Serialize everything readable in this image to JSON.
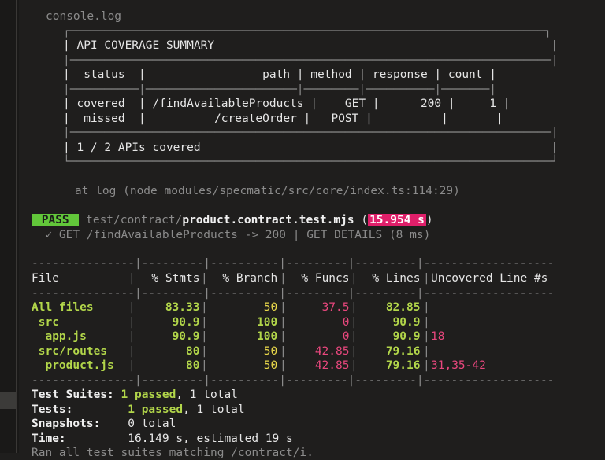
{
  "console_label": "console.log",
  "api_table": {
    "border_top": "┌─────────────────────────────────────────────────────────────────────┐",
    "title_line": "| API COVERAGE SUMMARY                                                 |",
    "sep1": "|──────────────────────────────────────────────────────────────────────|",
    "header_line": "|  status  |                 path | method | response | count |",
    "sep2": "|──────────|──────────────────────|────────|──────────|───────|",
    "rows": [
      "| covered  | /findAvailableProducts |    GET |      200 |     1 |",
      "|  missed  |          /createOrder |   POST |          |       |"
    ],
    "sep3": "|──────────────────────────────────────────────────────────────────────|",
    "summary_line": "| 1 / 2 APIs covered                                                   |",
    "border_bottom": "└──────────────────────────────────────────────────────────────────────┘"
  },
  "stack_trace": "at log (node_modules/specmatic/src/core/index.ts:114:29)",
  "test_result": {
    "badge": " PASS ",
    "path_prefix": " test/contract/",
    "file": "product.contract.test.mjs",
    "open_paren": " (",
    "duration": "15.954 s",
    "close_paren": ")",
    "check_line": "  ✓ GET /findAvailableProducts -> 200 | GET_DETAILS (8 ms)"
  },
  "coverage": {
    "rule": "---------------|---------|----------|---------|---------|-------------------",
    "header": {
      "file": "File",
      "stmts": "% Stmts",
      "branch": "% Branch",
      "funcs": "% Funcs",
      "lines": "% Lines",
      "uncovered": "Uncovered Line #s"
    },
    "rows": [
      {
        "file": "All files",
        "stmts": "83.33",
        "branch": "50",
        "funcs": "37.5",
        "lines": "82.85",
        "uncovered": ""
      },
      {
        "file": " src",
        "stmts": "90.9",
        "branch": "100",
        "funcs": "0",
        "lines": "90.9",
        "uncovered": ""
      },
      {
        "file": "  app.js",
        "stmts": "90.9",
        "branch": "100",
        "funcs": "0",
        "lines": "90.9",
        "uncovered": "18"
      },
      {
        "file": " src/routes",
        "stmts": "80",
        "branch": "50",
        "funcs": "42.85",
        "lines": "79.16",
        "uncovered": ""
      },
      {
        "file": "  product.js",
        "stmts": "80",
        "branch": "50",
        "funcs": "42.85",
        "lines": "79.16",
        "uncovered": "31,35-42"
      }
    ]
  },
  "summary": {
    "suites_label": "Test Suites:",
    "suites_passed": "1 passed",
    "suites_total": ", 1 total",
    "tests_label": "Tests:",
    "tests_passed": "1 passed",
    "tests_total": ", 1 total",
    "snapshots_label": "Snapshots:",
    "snapshots_value": "0 total",
    "time_label": "Time:",
    "time_value": "16.149 s, estimated 19 s",
    "ran_line": "Ran all test suites matching /contract/i."
  },
  "colors": {
    "background": "#1f1e1d",
    "pass_badge": "#62c73a",
    "duration_badge": "#e01f6a",
    "green": "#b2d64a",
    "yellow": "#e9d84a",
    "pink": "#e8477d"
  }
}
